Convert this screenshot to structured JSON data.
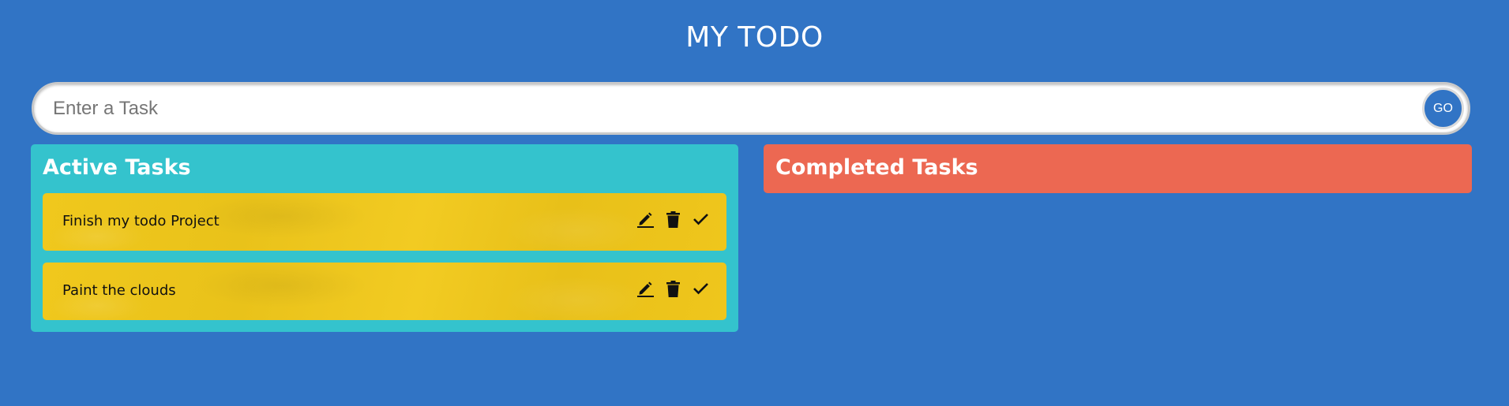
{
  "header": {
    "title": "MY TODO"
  },
  "input": {
    "placeholder": "Enter a Task",
    "value": "",
    "go_label": "GO"
  },
  "active": {
    "title": "Active Tasks",
    "tasks": [
      {
        "label": "Finish my todo Project"
      },
      {
        "label": "Paint the clouds"
      }
    ]
  },
  "completed": {
    "title": "Completed Tasks",
    "tasks": []
  },
  "icons": {
    "edit": "pencil-icon",
    "delete": "trash-icon",
    "complete": "checkmark-icon"
  },
  "colors": {
    "background": "#3174c5",
    "active_panel": "#34c3cd",
    "completed_panel": "#ec6852",
    "task_card": "#eec61c"
  }
}
